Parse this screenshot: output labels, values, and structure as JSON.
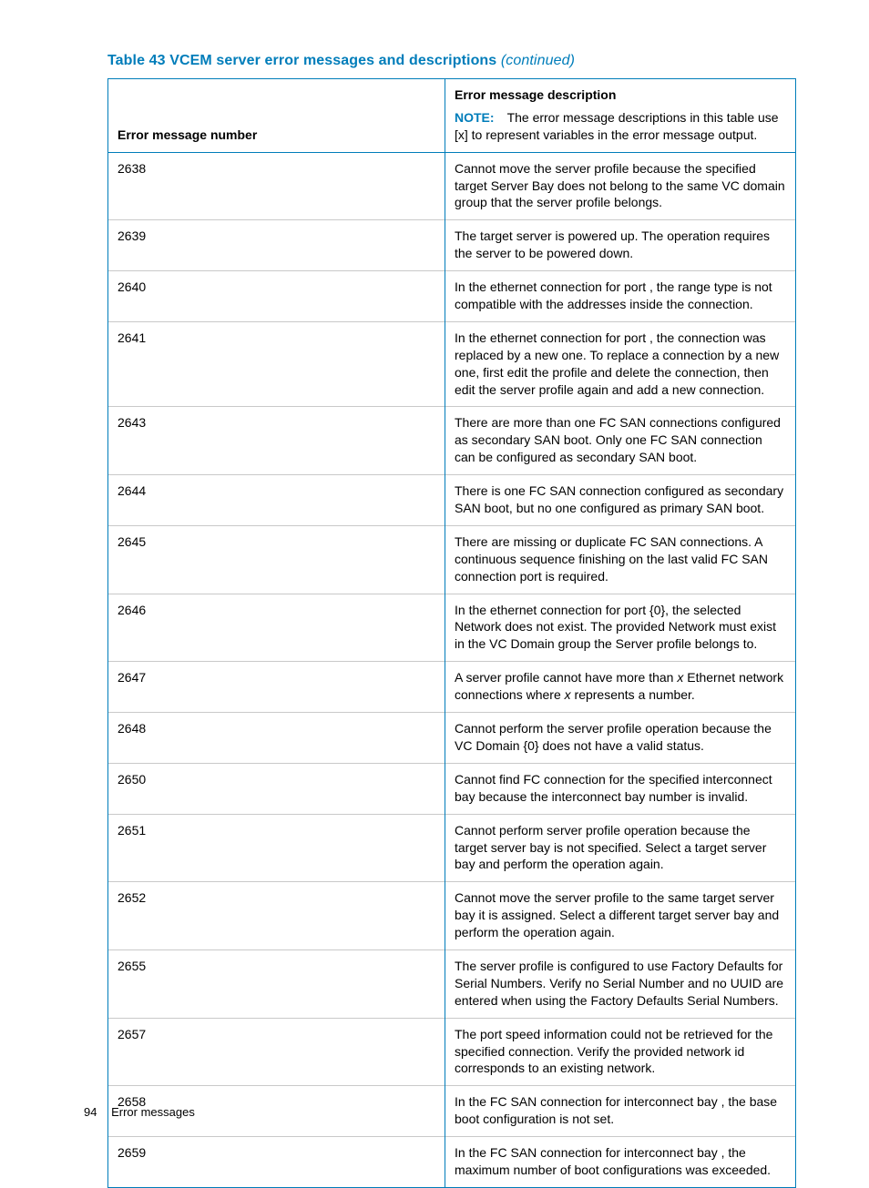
{
  "caption": {
    "prefix": "Table 43 VCEM server error messages and descriptions",
    "suffix": "(continued)"
  },
  "headers": {
    "num": "Error message number",
    "desc_label": "Error message description",
    "note_label": "NOTE:",
    "note_text": "The error message descriptions in this table use [x] to represent variables in the error message output."
  },
  "rows": [
    {
      "num": "2638",
      "desc": "Cannot move the server profile because the specified target Server Bay does not belong to the same VC domain group that the server profile belongs."
    },
    {
      "num": "2639",
      "desc": "The target server is powered up. The operation requires the server to be powered down."
    },
    {
      "num": "2640",
      "desc": "In the ethernet connection for port , the range type is not compatible with the addresses inside the connection."
    },
    {
      "num": "2641",
      "desc": "In the ethernet connection for port , the connection was replaced by a new one. To replace a connection by a new one, first edit the profile and delete the connection, then edit the server profile again and add a new connection."
    },
    {
      "num": "2643",
      "desc": "There are more than one FC SAN connections configured as secondary SAN boot. Only one FC SAN connection can be configured as secondary SAN boot."
    },
    {
      "num": "2644",
      "desc": "There is one FC SAN connection configured as secondary SAN boot, but no one configured as primary SAN boot."
    },
    {
      "num": "2645",
      "desc": "There are missing or duplicate FC SAN connections. A continuous sequence finishing on the last valid FC SAN connection port is required."
    },
    {
      "num": "2646",
      "desc": "In the ethernet connection for port {0}, the selected Network does not exist. The provided Network must exist in the VC Domain group the Server profile belongs to."
    },
    {
      "num": "2647",
      "desc_html": "A server profile cannot have more than <em class=\"var\">x</em> Ethernet network connections where <em class=\"var\">x</em> represents a number."
    },
    {
      "num": "2648",
      "desc": "Cannot perform the server profile operation because the VC Domain {0} does not have a valid status."
    },
    {
      "num": "2650",
      "desc": "Cannot find FC connection for the specified interconnect bay because the interconnect bay number is invalid."
    },
    {
      "num": "2651",
      "desc": "Cannot perform server profile operation because the target server bay is not specified. Select a target server bay and perform the operation again."
    },
    {
      "num": "2652",
      "desc": "Cannot move the server profile to the same target server bay it is assigned. Select a different target server bay and perform the operation again."
    },
    {
      "num": "2655",
      "desc": "The server profile is configured to use Factory Defaults for Serial Numbers. Verify no Serial Number and no UUID are entered when using the Factory Defaults Serial Numbers."
    },
    {
      "num": "2657",
      "desc": "The port speed information could not be retrieved for the specified connection. Verify the provided network id corresponds to an existing network."
    },
    {
      "num": "2658",
      "desc": "In the FC SAN connection for interconnect bay , the base boot configuration is not set."
    },
    {
      "num": "2659",
      "desc": "In the FC SAN connection for interconnect bay , the maximum number of boot configurations was exceeded."
    }
  ],
  "footer": {
    "page": "94",
    "section": "Error messages"
  }
}
